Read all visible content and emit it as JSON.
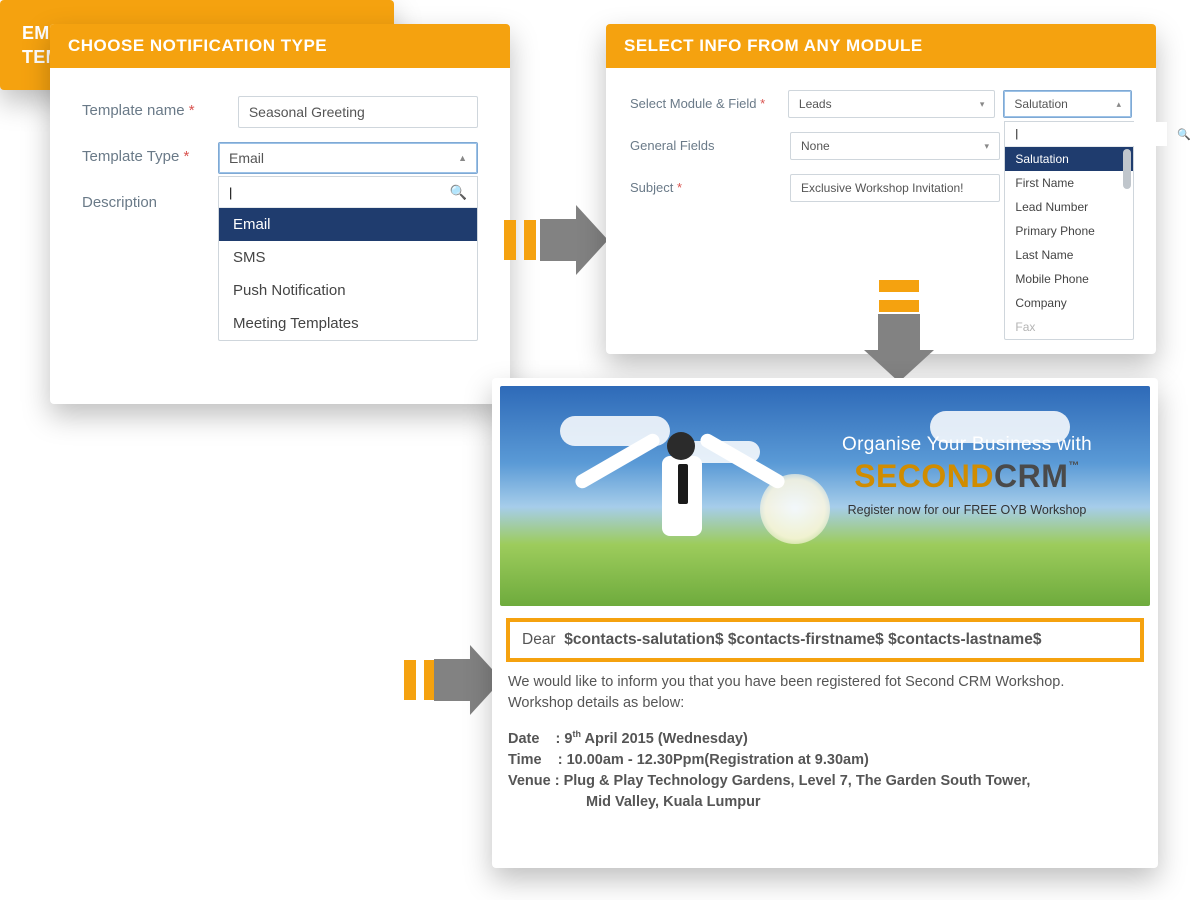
{
  "card1": {
    "title": "CHOOSE NOTIFICATION TYPE",
    "labels": {
      "name": "Template name",
      "type": "Template Type",
      "desc": "Description"
    },
    "values": {
      "name": "Seasonal Greeting",
      "type": "Email"
    },
    "dropdown": {
      "searchPlaceholder": "",
      "options": [
        "Email",
        "SMS",
        "Push Notification",
        "Meeting Templates"
      ],
      "selected": "Email"
    }
  },
  "card2": {
    "title": "SELECT INFO FROM ANY MODULE",
    "labels": {
      "module": "Select Module & Field",
      "general": "General Fields",
      "subject": "Subject"
    },
    "values": {
      "module": "Leads",
      "general": "None",
      "subject": "Exclusive Workshop Invitation!",
      "field": "Salutation"
    },
    "fieldDropdown": {
      "options": [
        "Salutation",
        "First Name",
        "Lead Number",
        "Primary Phone",
        "Last Name",
        "Mobile Phone",
        "Company",
        "Fax"
      ],
      "selected": "Salutation"
    }
  },
  "card3": {
    "title": "EMAIL AND SMS MARKETING TEMPLATES"
  },
  "preview": {
    "banner": {
      "line1": "Organise Your Business with",
      "brand1": "SECOND",
      "brand2": "CRM",
      "tm": "™",
      "line3": "Register now for our FREE OYB Workshop"
    },
    "dear": {
      "prefix": "Dear",
      "tokens": "$contacts-salutation$ $contacts-firstname$ $contacts-lastname$"
    },
    "introA": "We would like to inform you that you have been registered fot Second CRM Workshop.",
    "introB": "Workshop details as below:",
    "dateLabel": "Date",
    "dateValue": "9th April 2015 (Wednesday)",
    "dateDay": "9",
    "dateOrd": "th",
    "dateRest": " April 2015 (Wednesday)",
    "timeLabel": "Time",
    "timeValue": "10.00am - 12.30Ppm(Registration at 9.30am)",
    "venueLabel": "Venue",
    "venueLine1": "Plug & Play Technology Gardens, Level 7, The Garden South Tower,",
    "venueLine2": "Mid Valley, Kuala Lumpur"
  }
}
